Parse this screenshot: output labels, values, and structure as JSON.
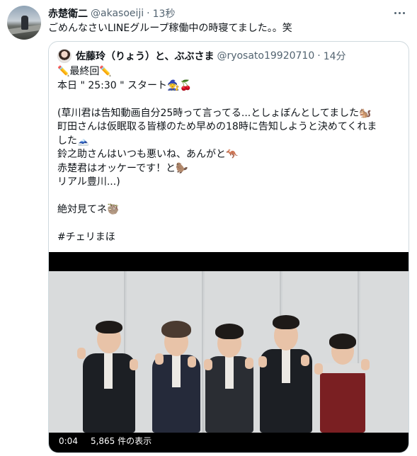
{
  "tweet": {
    "author_name": "赤楚衛二",
    "author_handle": "@akasoeiji",
    "separator": "·",
    "time": "13秒",
    "text": "ごめんなさいLINEグループ稼働中の時寝てました。。笑"
  },
  "quote": {
    "author_name": "佐藤玲（りょう）と、ぶぶさま",
    "author_handle": "@ryosato19920710",
    "separator": "·",
    "time": "14分",
    "lines": [
      "✏️最終回✏️",
      "本日 \" 25:30 \" スタート🧙🍒",
      "",
      "(草川君は告知動画自分25時って言ってる...としょぼんとしてました🐿️",
      "町田さんは仮眠取る皆様のため早めの18時に告知しようと決めてくれま",
      "した🗻",
      "鈴之助さんはいつも悪いね、あんがと🦘",
      "赤楚君はオッケーです！と🦫",
      "リアル豊川...)",
      "",
      "絶対見てネ🦥",
      "",
      "#チェリまほ"
    ]
  },
  "video": {
    "timestamp": "0:04",
    "views": "5,865 件の表示"
  }
}
